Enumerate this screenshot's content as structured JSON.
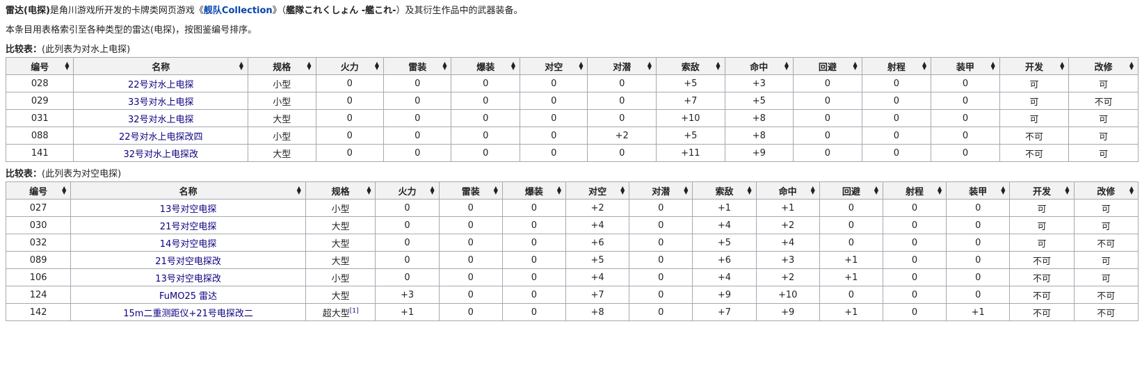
{
  "intro": {
    "term": "雷达(电探)",
    "text1": "是角川游戏所开发的卡牌类网页游戏《",
    "game_link": "舰队Collection",
    "text2": "》（",
    "jp_title": "艦隊これくしょん -艦これ-",
    "text3": "）及其衍生作品中的武器装备。"
  },
  "note": "本条目用表格索引至各种类型的雷达(电探)，按图鉴编号排序。",
  "table1": {
    "label": "比较表：",
    "caption": "(此列表为对水上电探)",
    "columns": [
      "编号",
      "名称",
      "规格",
      "火力",
      "雷装",
      "爆装",
      "对空",
      "对潜",
      "索敌",
      "命中",
      "回避",
      "射程",
      "装甲",
      "开发",
      "改修"
    ],
    "rows": [
      [
        "028",
        "22号对水上电探",
        "小型",
        "0",
        "0",
        "0",
        "0",
        "0",
        "+5",
        "+3",
        "0",
        "0",
        "0",
        "可",
        "可"
      ],
      [
        "029",
        "33号对水上电探",
        "小型",
        "0",
        "0",
        "0",
        "0",
        "0",
        "+7",
        "+5",
        "0",
        "0",
        "0",
        "可",
        "不可"
      ],
      [
        "031",
        "32号对水上电探",
        "大型",
        "0",
        "0",
        "0",
        "0",
        "0",
        "+10",
        "+8",
        "0",
        "0",
        "0",
        "可",
        "可"
      ],
      [
        "088",
        "22号对水上电探改四",
        "小型",
        "0",
        "0",
        "0",
        "0",
        "+2",
        "+5",
        "+8",
        "0",
        "0",
        "0",
        "不可",
        "可"
      ],
      [
        "141",
        "32号对水上电探改",
        "大型",
        "0",
        "0",
        "0",
        "0",
        "0",
        "+11",
        "+9",
        "0",
        "0",
        "0",
        "不可",
        "可"
      ]
    ]
  },
  "table2": {
    "label": "比较表：",
    "caption": "(此列表为对空电探)",
    "columns": [
      "编号",
      "名称",
      "规格",
      "火力",
      "雷装",
      "爆装",
      "对空",
      "对潜",
      "索敌",
      "命中",
      "回避",
      "射程",
      "装甲",
      "开发",
      "改修"
    ],
    "rows": [
      [
        "027",
        "13号对空电探",
        "小型",
        "0",
        "0",
        "0",
        "+2",
        "0",
        "+1",
        "+1",
        "0",
        "0",
        "0",
        "可",
        "可"
      ],
      [
        "030",
        "21号对空电探",
        "大型",
        "0",
        "0",
        "0",
        "+4",
        "0",
        "+4",
        "+2",
        "0",
        "0",
        "0",
        "可",
        "可"
      ],
      [
        "032",
        "14号对空电探",
        "大型",
        "0",
        "0",
        "0",
        "+6",
        "0",
        "+5",
        "+4",
        "0",
        "0",
        "0",
        "可",
        "不可"
      ],
      [
        "089",
        "21号对空电探改",
        "大型",
        "0",
        "0",
        "0",
        "+5",
        "0",
        "+6",
        "+3",
        "+1",
        "0",
        "0",
        "不可",
        "可"
      ],
      [
        "106",
        "13号对空电探改",
        "小型",
        "0",
        "0",
        "0",
        "+4",
        "0",
        "+4",
        "+2",
        "+1",
        "0",
        "0",
        "不可",
        "可"
      ],
      [
        "124",
        "FuMO25 雷达",
        "大型",
        "+3",
        "0",
        "0",
        "+7",
        "0",
        "+9",
        "+10",
        "0",
        "0",
        "0",
        "不可",
        "不可"
      ],
      [
        "142",
        "15m二重测距仪+21号电探改二",
        "超大型",
        "+1",
        "0",
        "0",
        "+8",
        "0",
        "+7",
        "+9",
        "+1",
        "0",
        "+1",
        "不可",
        "不可"
      ]
    ],
    "footnote": "[1]"
  },
  "icons": {
    "sort": "sort-arrows-icon"
  }
}
